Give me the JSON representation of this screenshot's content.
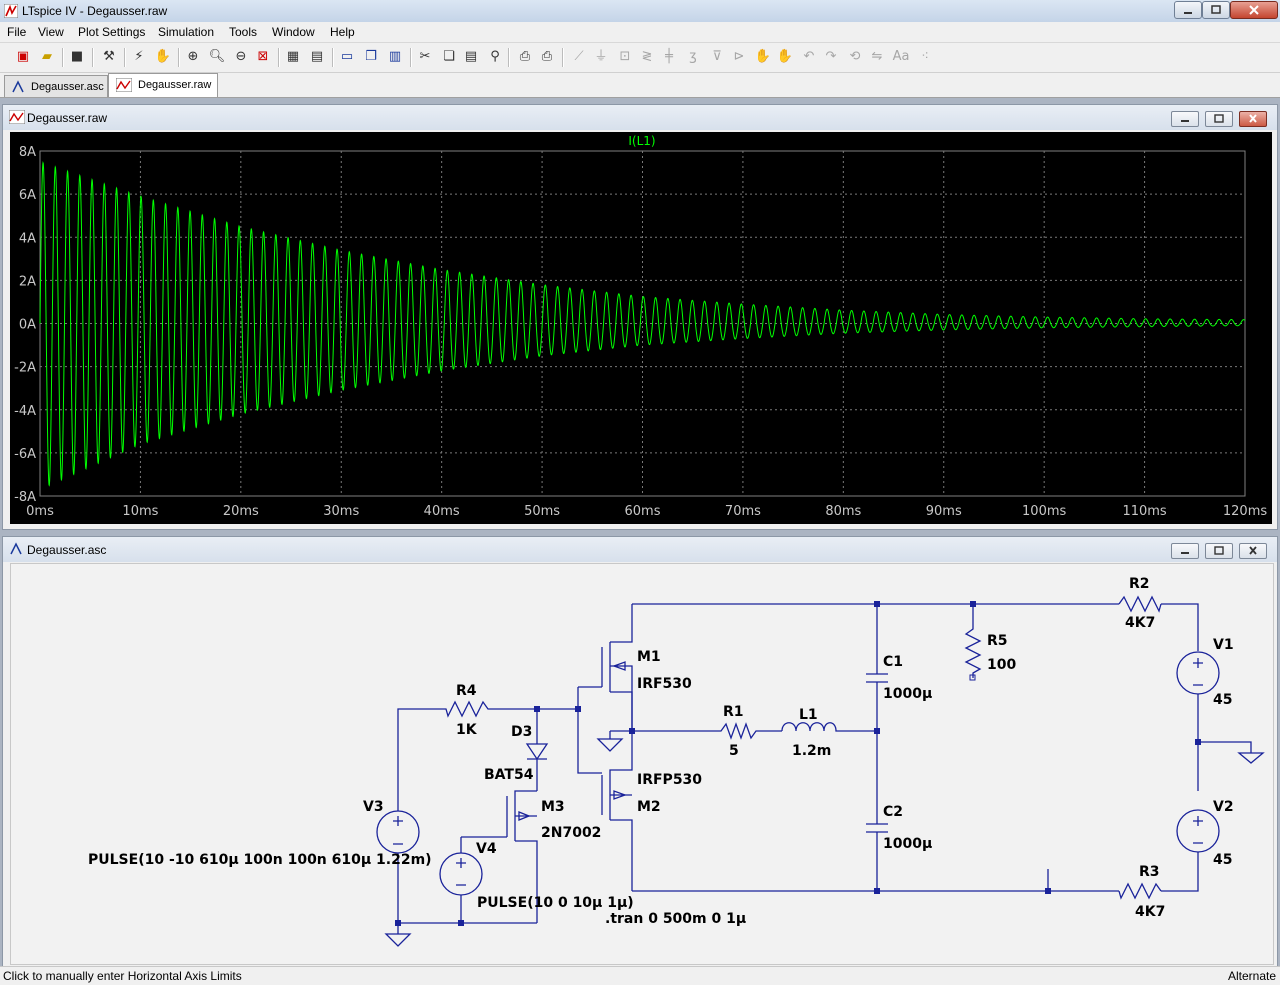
{
  "app": {
    "title": "LTspice IV - Degausser.raw"
  },
  "menu": [
    "File",
    "View",
    "Plot Settings",
    "Simulation",
    "Tools",
    "Window",
    "Help"
  ],
  "tabs": [
    {
      "label": "Degausser.asc"
    },
    {
      "label": "Degausser.raw"
    }
  ],
  "plot_window": {
    "title": "Degausser.raw"
  },
  "schematic_window": {
    "title": "Degausser.asc"
  },
  "status": {
    "left": "Click to manually enter Horizontal Axis Limits",
    "right": "Alternate"
  },
  "chart_data": {
    "type": "line",
    "title": "I(L1)",
    "trace_color": "#00ff00",
    "background": "#000000",
    "grid": true,
    "xlim": [
      0,
      120
    ],
    "ylim": [
      -8,
      8
    ],
    "xticks": [
      "0ms",
      "10ms",
      "20ms",
      "30ms",
      "40ms",
      "50ms",
      "60ms",
      "70ms",
      "80ms",
      "90ms",
      "100ms",
      "110ms",
      "120ms"
    ],
    "yticks": [
      "8A",
      "6A",
      "4A",
      "2A",
      "0A",
      "-2A",
      "-4A",
      "-6A",
      "-8A"
    ],
    "series": [
      {
        "name": "I(L1)",
        "period_ms": 1.22,
        "envelope_ms": [
          0,
          10,
          20,
          30,
          40,
          50,
          60,
          70,
          80,
          90,
          100,
          110,
          120
        ],
        "peak_A": [
          7.5,
          5.9,
          4.5,
          3.4,
          2.5,
          1.8,
          1.25,
          0.9,
          0.62,
          0.42,
          0.3,
          0.22,
          0.18
        ],
        "trough_A": [
          -7.7,
          -5.6,
          -4.2,
          -3.1,
          -2.2,
          -1.5,
          -1.0,
          -0.7,
          -0.45,
          -0.3,
          -0.2,
          -0.15,
          -0.1
        ]
      }
    ]
  },
  "schematic": {
    "labels": {
      "R4": "R4",
      "R4v": "1K",
      "D3": "D3",
      "D3v": "BAT54",
      "M3": "M3",
      "M3v": "2N7002",
      "V3": "V3",
      "V3v": "PULSE(10 -10 610µ 100n 100n 610µ 1.22m)",
      "V4": "V4",
      "V4v": "PULSE(10 0 10µ 1µ)",
      "M1": "M1",
      "M1v": "IRF530",
      "M2": "M2",
      "M2v": "IRFP530",
      "R1": "R1",
      "R1v": "5",
      "L1": "L1",
      "L1v": "1.2m",
      "C1": "C1",
      "C1v": "1000µ",
      "C2": "C2",
      "C2v": "1000µ",
      "R5": "R5",
      "R5v": "100",
      "R2": "R2",
      "R2v": "4K7",
      "R3": "R3",
      "R3v": "4K7",
      "V1": "V1",
      "V1v": "45",
      "V2": "V2",
      "V2v": "45",
      "tran": ".tran 0 500m 0 1µ"
    }
  }
}
